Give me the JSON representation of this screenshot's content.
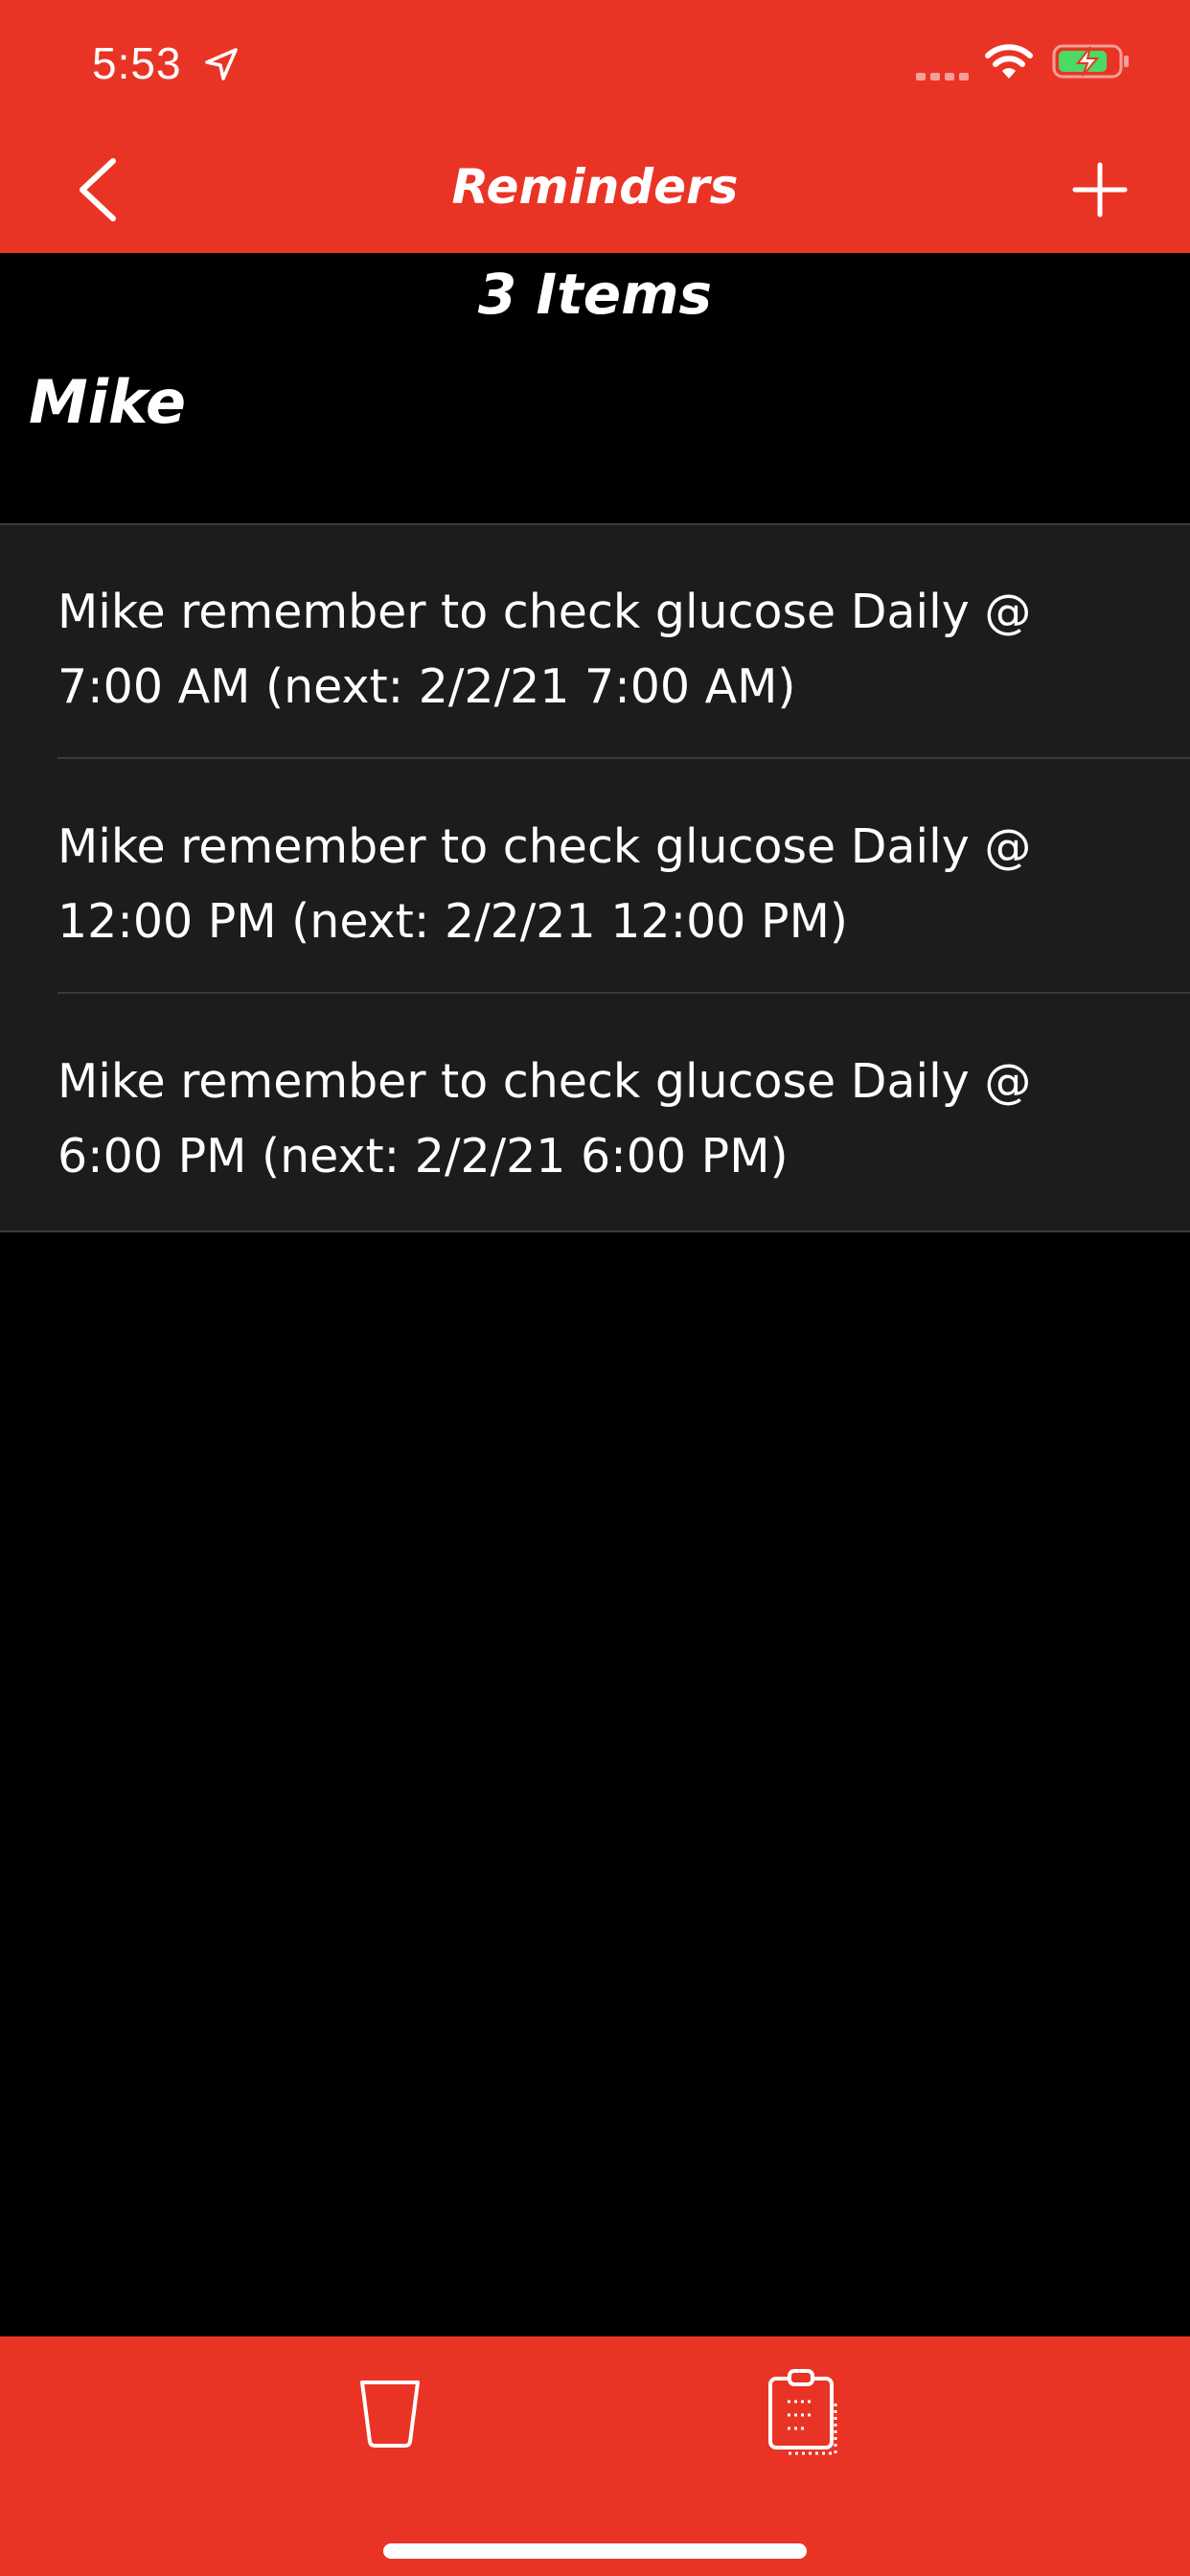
{
  "status_bar": {
    "time": "5:53"
  },
  "nav_bar": {
    "title": "Reminders"
  },
  "count_label": "3 Items",
  "section": {
    "title": "Mike"
  },
  "reminders": [
    {
      "line1": "Mike remember to check glucose Daily @",
      "line2": "7:00 AM (next: 2/2/21 7:00 AM)"
    },
    {
      "line1": "Mike remember to check glucose Daily @",
      "line2": "12:00 PM (next: 2/2/21 12:00 PM)"
    },
    {
      "line1": "Mike remember to check glucose Daily @",
      "line2": "6:00 PM (next: 2/2/21 6:00 PM)"
    }
  ],
  "icons": {
    "back": "chevron-left-icon",
    "add": "plus-icon",
    "trash": "trash-icon",
    "clipboard": "clipboard-icon",
    "location": "location-arrow-icon",
    "wifi": "wifi-icon",
    "battery": "battery-charging-icon",
    "signal": "cellular-signal-icon"
  },
  "colors": {
    "accent": "#e93425",
    "background": "#000000",
    "row_background": "#1c1c1e",
    "separator": "#3a3a3c",
    "battery_fill": "#4cd964"
  }
}
